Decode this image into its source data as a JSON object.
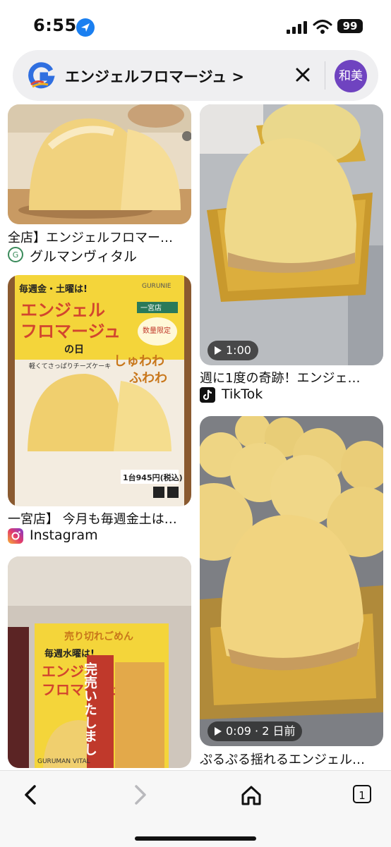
{
  "status_bar": {
    "time": "6:55",
    "battery": "99"
  },
  "search": {
    "query": "エンジェルフロマージュ >",
    "avatar_text": "和美"
  },
  "results": [
    {
      "caption": "全店】エンジェルフロマー…",
      "source": "グルマンヴィタル"
    },
    {
      "caption": "週に1度の奇跡！エンジェ…",
      "source": "TikTok",
      "video_duration": "1:00"
    },
    {
      "caption": "一宮店】 今月も毎週金土は…",
      "source": "Instagram",
      "poster": {
        "top_line": "毎週金・土曜は!",
        "title_line1": "エンジェル",
        "title_line2": "フロマージュ",
        "title_line3": "の日",
        "brand": "GURUNIE",
        "store": "一宮店",
        "limited": "数量限定",
        "slogan1": "しゅわわ",
        "slogan2": "ふわわ",
        "sub": "軽くてさっぱりチーズケーキ",
        "price": "1台945円(税込)"
      }
    },
    {
      "caption": "ぷるぷる揺れるエンジェル…",
      "source": "",
      "video_duration": "0:09 · 2 日前"
    },
    {
      "caption": "",
      "source": "",
      "poster": {
        "banner": "売り切れごめん",
        "top_line": "毎週水曜は!",
        "title_line1": "エンジェル",
        "title_line2": "フロマージュ",
        "soldout": "完売いたしまし",
        "brand": "GURUMAN VITAL"
      }
    }
  ],
  "bottom_bar": {
    "tab_count": "1"
  },
  "colors": {
    "accent": "#1a7ff0",
    "avatar": "#6f43c0",
    "poster_yellow": "#f4d53a",
    "cake": "#f1d27e"
  }
}
